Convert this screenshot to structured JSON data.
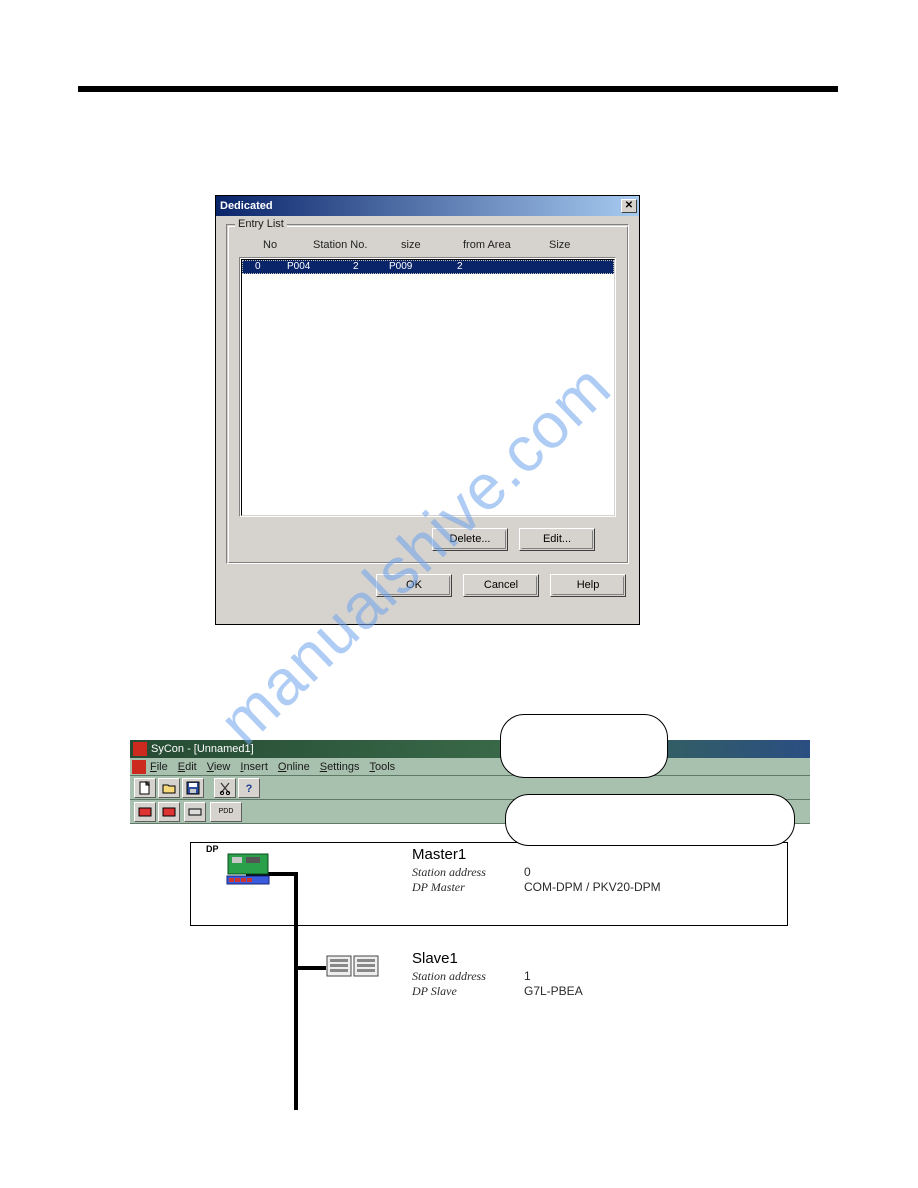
{
  "dialog": {
    "title": "Dedicated",
    "groupbox_label": "Entry List",
    "columns": {
      "no": "No",
      "station_no": "Station No.",
      "size": "size",
      "from_area": "from Area",
      "size2": "Size"
    },
    "row": {
      "no": "0",
      "val1": "P004",
      "val2": "2",
      "val3": "P009",
      "val4": "2"
    },
    "buttons": {
      "delete": "Delete...",
      "edit": "Edit...",
      "ok": "OK",
      "cancel": "Cancel",
      "help": "Help"
    }
  },
  "sycon": {
    "title": "SyCon - [Unnamed1]",
    "menu": {
      "file": "File",
      "edit": "Edit",
      "view": "View",
      "insert": "Insert",
      "online": "Online",
      "settings": "Settings",
      "tools": "Tools"
    },
    "master": {
      "name": "Master1",
      "addr_label": "Station address",
      "addr_value": "0",
      "type_label": "DP Master",
      "type_value": "COM-DPM / PKV20-DPM"
    },
    "slave": {
      "name": "Slave1",
      "addr_label": "Station address",
      "addr_value": "1",
      "type_label": "DP Slave",
      "type_value": "G7L-PBEA"
    },
    "dp_label": "DP"
  }
}
